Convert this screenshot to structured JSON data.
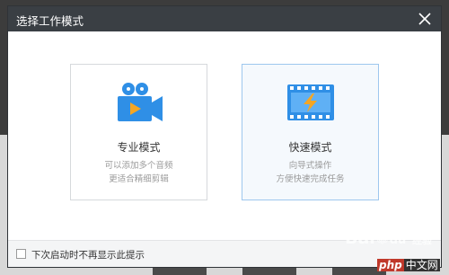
{
  "dialog": {
    "title": "选择工作模式",
    "close_icon": "close-icon"
  },
  "modes": [
    {
      "name": "专业模式",
      "desc_line1": "可以添加多个音频",
      "desc_line2": "更适合精细剪辑",
      "icon": "movie-camera-icon",
      "selected": false
    },
    {
      "name": "快速模式",
      "desc_line1": "向导式操作",
      "desc_line2": "方便快速完成任务",
      "icon": "film-strip-lightning-icon",
      "selected": true
    }
  ],
  "footer": {
    "checkbox_label": "下次启动时不再显示此提示",
    "checked": false
  },
  "watermark": {
    "baidu": "Bai",
    "du_suffix": "du",
    "jingyan": "经验",
    "php": "php",
    "site": "中文网"
  },
  "colors": {
    "titlebar": "#3a3f44",
    "icon_blue": "#2f8fe6",
    "icon_orange": "#f5a623",
    "selected_border": "#9ec7ee"
  }
}
